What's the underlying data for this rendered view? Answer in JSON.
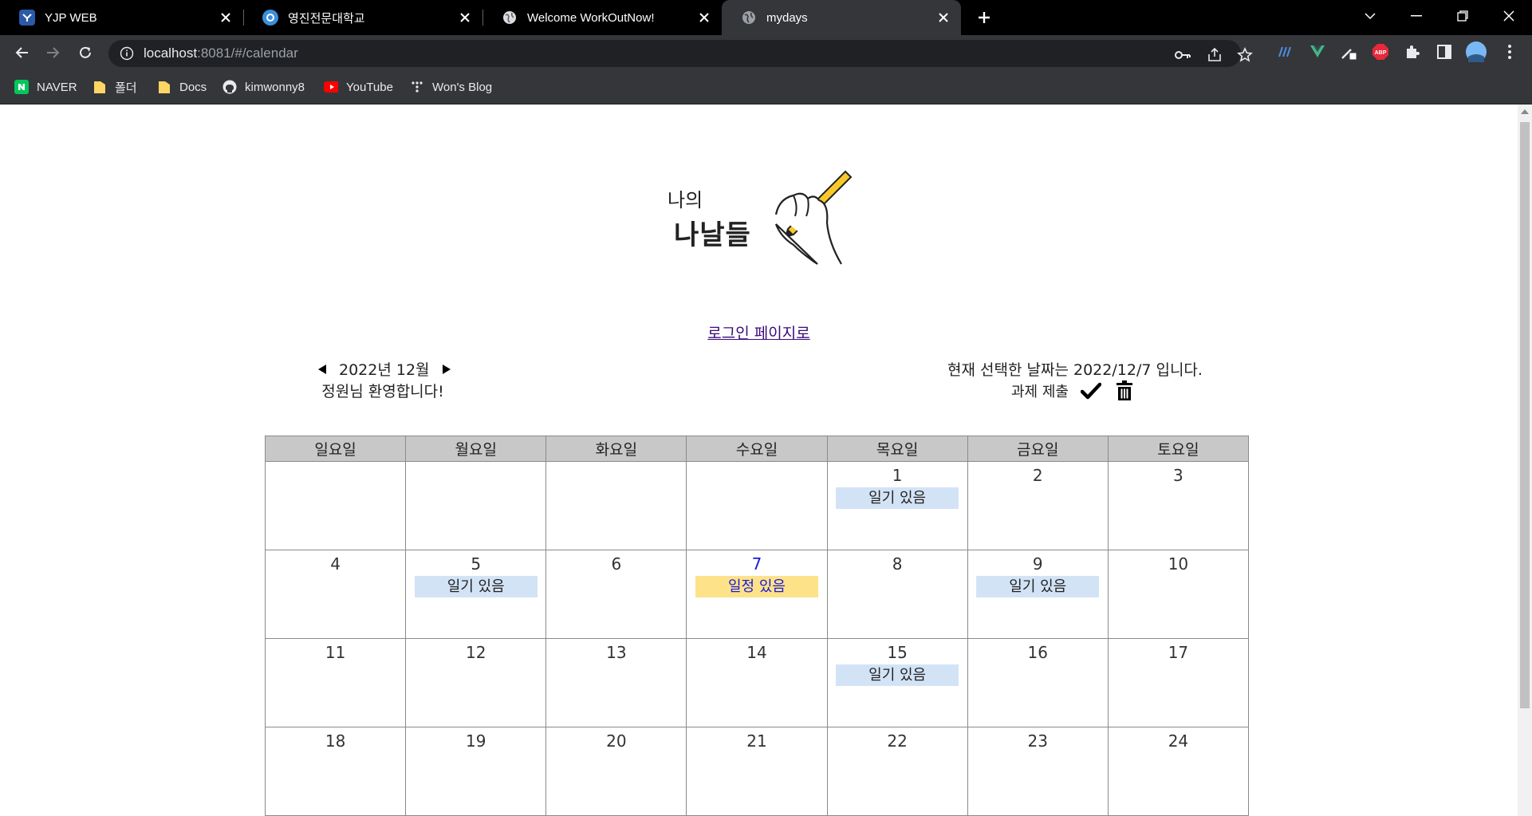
{
  "browser": {
    "tabs": [
      {
        "title": "YJP WEB",
        "favicon": "yjp-favicon-icon"
      },
      {
        "title": "영진전문대학교",
        "favicon": "yeungjin-favicon-icon"
      },
      {
        "title": "Welcome WorkOutNow!",
        "favicon": "globe-icon"
      },
      {
        "title": "mydays",
        "favicon": "globe-icon",
        "active": true
      }
    ],
    "url_host": "localhost",
    "url_rest": ":8081/#/calendar",
    "bookmarks": [
      {
        "label": "NAVER",
        "icon": "naver-icon"
      },
      {
        "label": "폴더",
        "icon": "folder-icon"
      },
      {
        "label": "Docs",
        "icon": "folder-icon"
      },
      {
        "label": "kimwonny8",
        "icon": "github-icon"
      },
      {
        "label": "YouTube",
        "icon": "youtube-icon"
      },
      {
        "label": "Won's Blog",
        "icon": "blog-icon"
      }
    ]
  },
  "logo": {
    "line1": "나의",
    "line2": "나날들"
  },
  "login_link": "로그인 페이지로",
  "header": {
    "month_label": "2022년 12월",
    "welcome": "정원님 환영합니다!",
    "selected_date_text": "현재 선택한 날짜는 2022/12/7 입니다.",
    "task_label": "과제 제출"
  },
  "calendar": {
    "weekdays": [
      "일요일",
      "월요일",
      "화요일",
      "수요일",
      "목요일",
      "금요일",
      "토요일"
    ],
    "weeks": [
      [
        {
          "day": ""
        },
        {
          "day": ""
        },
        {
          "day": ""
        },
        {
          "day": ""
        },
        {
          "day": "1",
          "badge": "일기 있음",
          "type": "diary"
        },
        {
          "day": "2"
        },
        {
          "day": "3"
        }
      ],
      [
        {
          "day": "4"
        },
        {
          "day": "5",
          "badge": "일기 있음",
          "type": "diary"
        },
        {
          "day": "6"
        },
        {
          "day": "7",
          "badge": "일정 있음",
          "type": "plan",
          "selected": true
        },
        {
          "day": "8"
        },
        {
          "day": "9",
          "badge": "일기 있음",
          "type": "diary"
        },
        {
          "day": "10"
        }
      ],
      [
        {
          "day": "11"
        },
        {
          "day": "12"
        },
        {
          "day": "13"
        },
        {
          "day": "14"
        },
        {
          "day": "15",
          "badge": "일기 있음",
          "type": "diary"
        },
        {
          "day": "16"
        },
        {
          "day": "17"
        }
      ],
      [
        {
          "day": "18"
        },
        {
          "day": "19"
        },
        {
          "day": "20"
        },
        {
          "day": "21"
        },
        {
          "day": "22"
        },
        {
          "day": "23"
        },
        {
          "day": "24"
        }
      ]
    ]
  },
  "colors": {
    "diary_badge": "#d3e3f6",
    "plan_badge": "#fde28a",
    "selected_day": "#1a1ad6",
    "header_bg": "#c8c8c8"
  }
}
